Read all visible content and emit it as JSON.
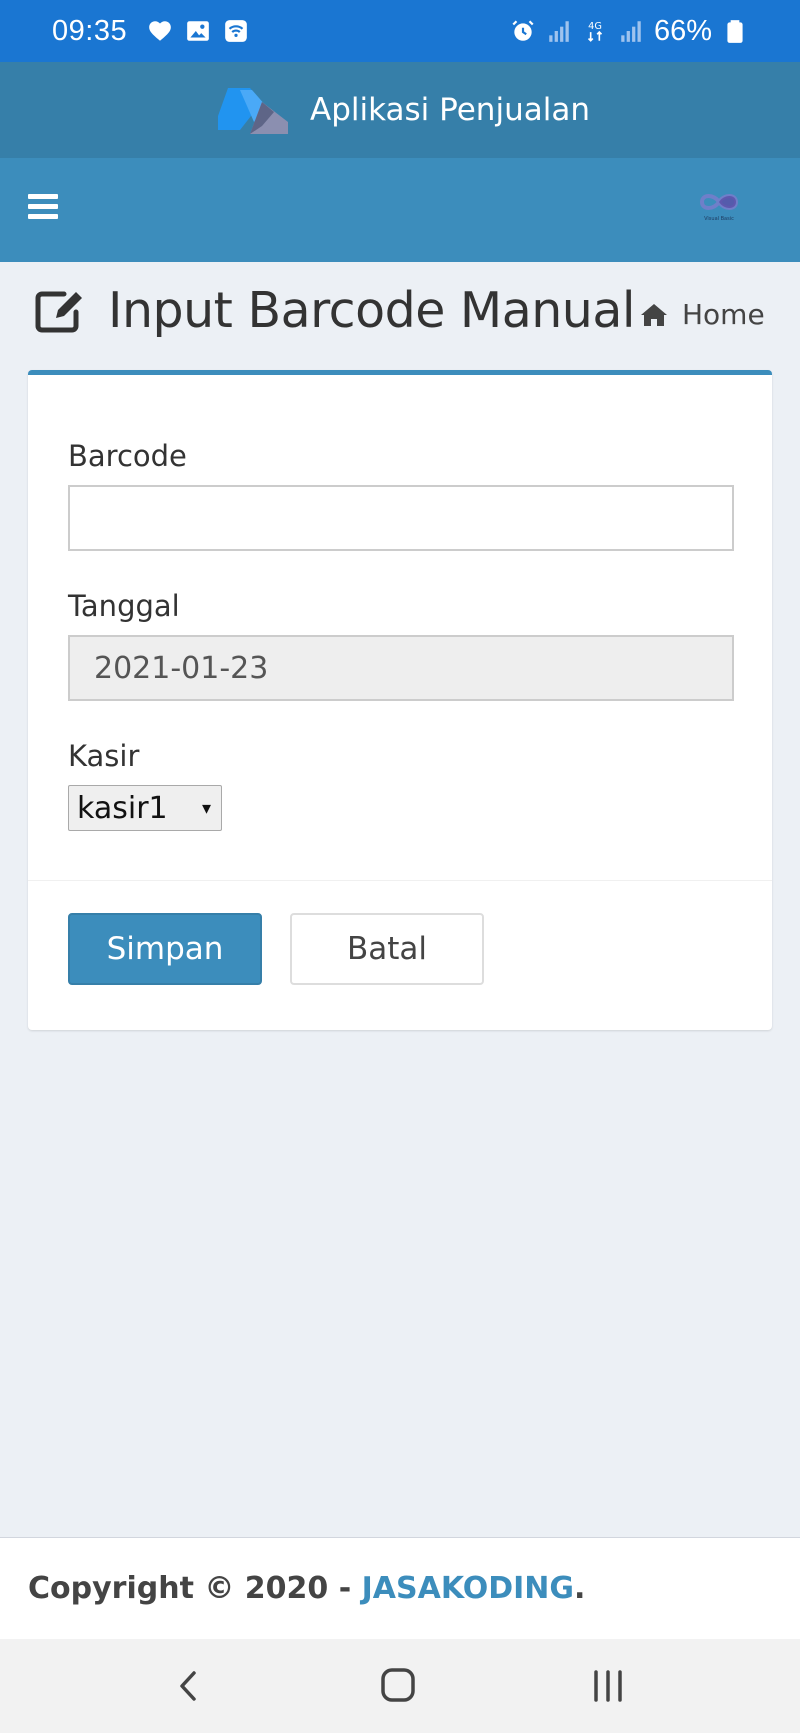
{
  "status_bar": {
    "time": "09:35",
    "battery": "66%",
    "network_label": "4G",
    "icons": [
      "heart-icon",
      "image-icon",
      "wifi-call-icon",
      "alarm-icon",
      "signal-icon",
      "4g-icon",
      "signal-icon",
      "battery-icon"
    ]
  },
  "app_header": {
    "title": "Aplikasi Penjualan",
    "logo_icon": "app-logo-icon"
  },
  "navbar": {
    "menu_icon": "hamburger-icon",
    "avatar_label": "Visual Basic"
  },
  "content_header": {
    "title": "Input Barcode Manual",
    "title_icon": "edit-icon",
    "breadcrumb": {
      "icon": "home-icon",
      "label": "Home"
    }
  },
  "form": {
    "barcode": {
      "label": "Barcode",
      "value": ""
    },
    "tanggal": {
      "label": "Tanggal",
      "value": "2021-01-23"
    },
    "kasir": {
      "label": "Kasir",
      "selected": "kasir1",
      "arrow": "▾"
    },
    "buttons": {
      "save": "Simpan",
      "cancel": "Batal"
    }
  },
  "footer": {
    "prefix": "Copyright © 2020 - ",
    "link": "JASAKODING",
    "suffix": "."
  },
  "colors": {
    "status_bar": "#1a76d2",
    "header": "#367fa9",
    "navbar": "#3c8dbc",
    "background": "#ecf0f5",
    "primary": "#3c8dbc"
  }
}
